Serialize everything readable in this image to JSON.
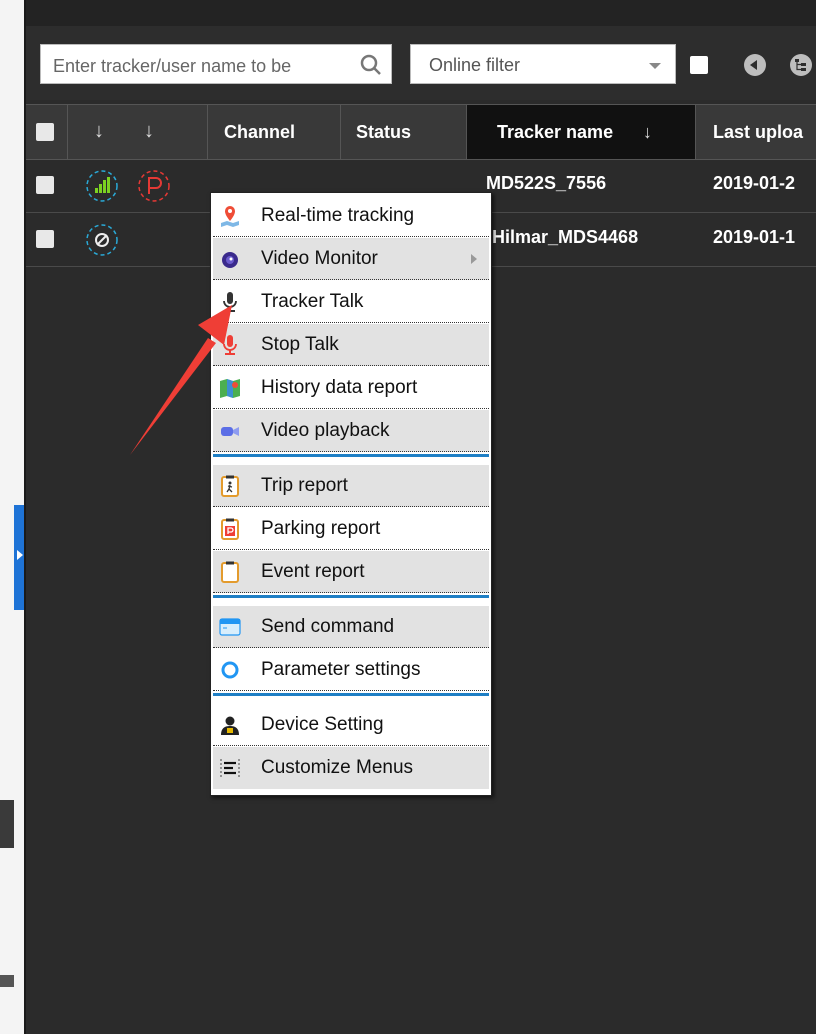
{
  "toolbar": {
    "search_placeholder": "Enter tracker/user name to be",
    "online_filter": "Online filter"
  },
  "grid": {
    "headers": {
      "channel": "Channel",
      "status": "Status",
      "tracker_name": "Tracker name",
      "last_upload": "Last uploa"
    },
    "rows": [
      {
        "tracker_name": "MD522S_7556",
        "last_upload": "2019-01-2"
      },
      {
        "tracker_name": "Hilmar_MDS4468",
        "last_upload": "2019-01-1"
      }
    ]
  },
  "context_menu": {
    "items": [
      {
        "label": "Real-time tracking",
        "icon": "map-pin-icon"
      },
      {
        "label": "Video Monitor",
        "icon": "video-monitor-icon"
      },
      {
        "label": "Tracker Talk",
        "icon": "microphone-icon"
      },
      {
        "label": "Stop Talk",
        "icon": "microphone-off-icon"
      },
      {
        "label": "History data report",
        "icon": "map-history-icon"
      },
      {
        "label": "Video playback",
        "icon": "video-camera-icon"
      },
      {
        "label": "Trip report",
        "icon": "trip-clipboard-icon"
      },
      {
        "label": "Parking report",
        "icon": "parking-clipboard-icon"
      },
      {
        "label": "Event report",
        "icon": "event-clipboard-icon"
      },
      {
        "label": "Send command",
        "icon": "command-window-icon"
      },
      {
        "label": "Parameter settings",
        "icon": "circle-settings-icon"
      },
      {
        "label": "Device Setting",
        "icon": "user-device-icon"
      },
      {
        "label": "Customize Menus",
        "icon": "menu-lines-icon"
      }
    ]
  },
  "colors": {
    "accent": "#1f7fc5",
    "annotation_arrow": "#ef3e36",
    "background": "#2b2b2b"
  }
}
